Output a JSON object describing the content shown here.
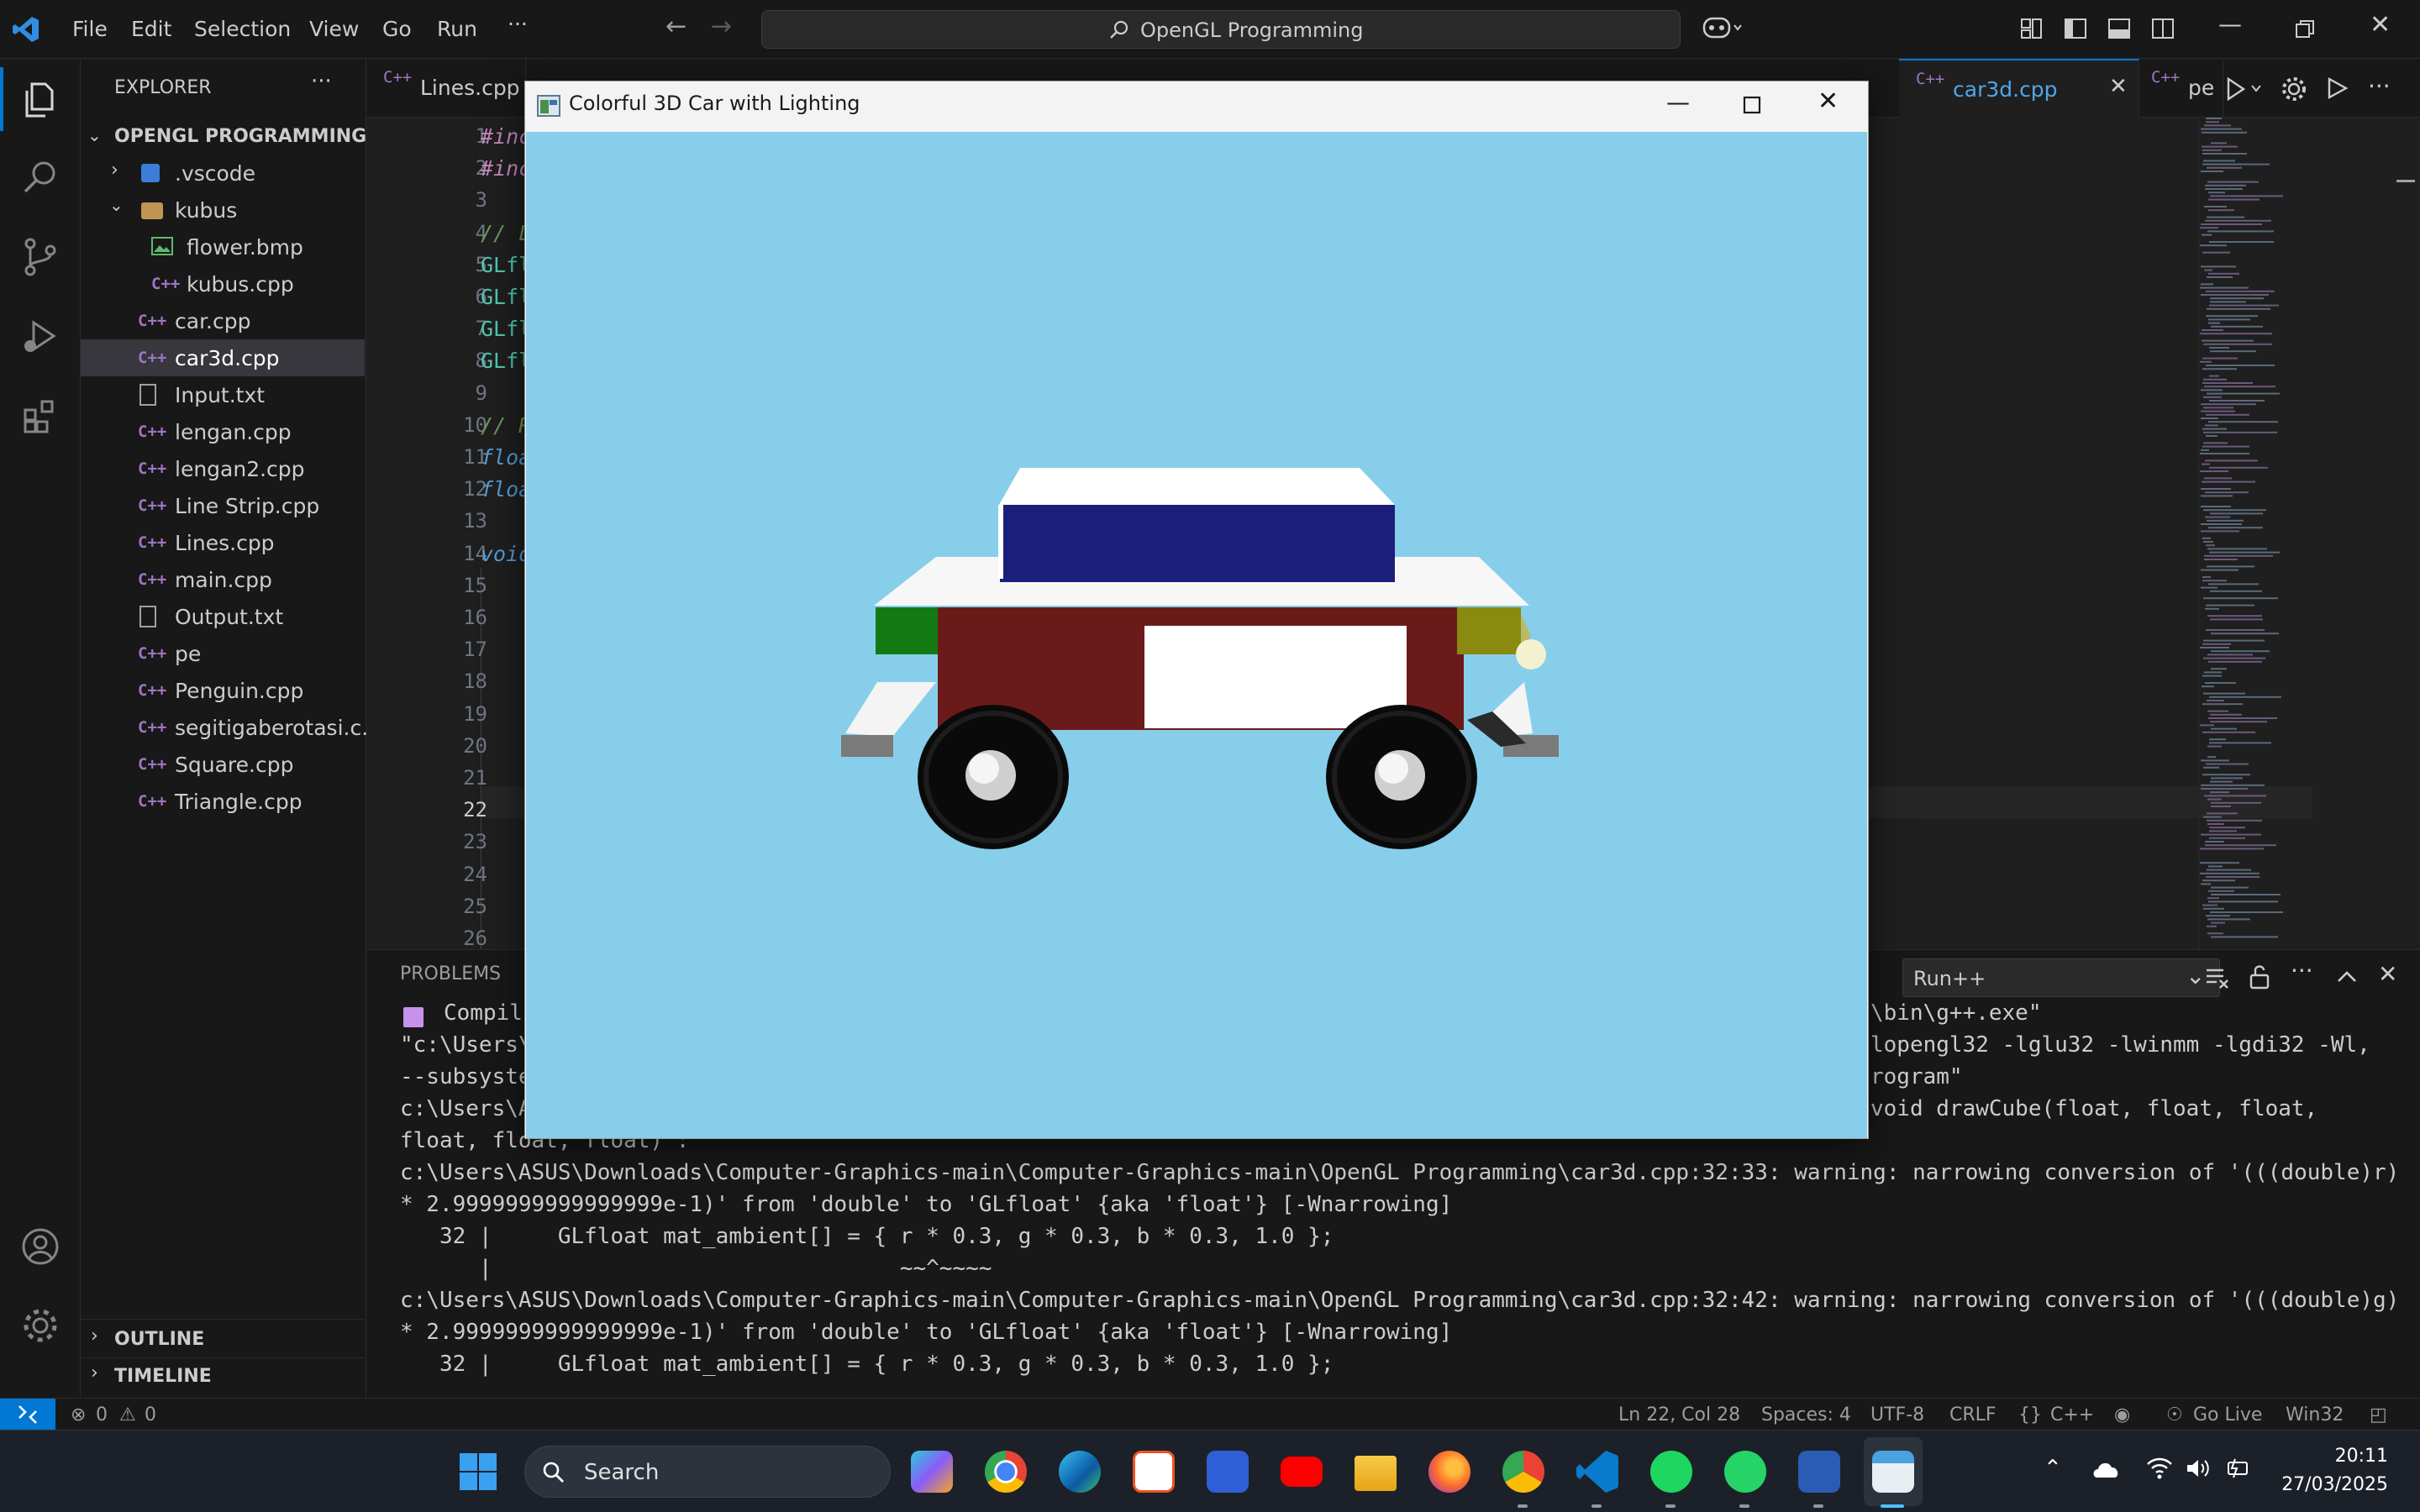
{
  "titlebar": {
    "menu": [
      "File",
      "Edit",
      "Selection",
      "View",
      "Go",
      "Run",
      "···"
    ],
    "search_text": "OpenGL Programming"
  },
  "sidebar": {
    "header": "EXPLORER",
    "project": "OPENGL PROGRAMMING",
    "items": [
      {
        "label": ".vscode",
        "type": "folder"
      },
      {
        "label": "kubus",
        "type": "folder-open"
      },
      {
        "label": "flower.bmp",
        "type": "image"
      },
      {
        "label": "kubus.cpp",
        "type": "cpp"
      },
      {
        "label": "car.cpp",
        "type": "cpp"
      },
      {
        "label": "car3d.cpp",
        "type": "cpp"
      },
      {
        "label": "Input.txt",
        "type": "txt"
      },
      {
        "label": "lengan.cpp",
        "type": "cpp"
      },
      {
        "label": "lengan2.cpp",
        "type": "cpp"
      },
      {
        "label": "Line Strip.cpp",
        "type": "cpp"
      },
      {
        "label": "Lines.cpp",
        "type": "cpp"
      },
      {
        "label": "main.cpp",
        "type": "cpp"
      },
      {
        "label": "Output.txt",
        "type": "txt"
      },
      {
        "label": "pe",
        "type": "txt"
      },
      {
        "label": "Penguin.cpp",
        "type": "cpp"
      },
      {
        "label": "segitigaberotasi.c...",
        "type": "cpp"
      },
      {
        "label": "Square.cpp",
        "type": "cpp"
      },
      {
        "label": "Triangle.cpp",
        "type": "cpp"
      }
    ],
    "outline": "OUTLINE",
    "timeline": "TIMELINE"
  },
  "tabs": [
    "Lines.cpp",
    "car3d.cpp",
    "pe"
  ],
  "editor": {
    "line_numbers": [
      "1",
      "2",
      "3",
      "4",
      "5",
      "6",
      "7",
      "8",
      "9",
      "10",
      "11",
      "12",
      "13",
      "14",
      "15",
      "16",
      "17",
      "18",
      "19",
      "20",
      "21",
      "22",
      "23",
      "24",
      "25",
      "26"
    ],
    "code_fragments": [
      "#inc",
      "#inc",
      "",
      "// L",
      "GLfl",
      "GLfl",
      "GLfl",
      "GLfl",
      "",
      "// R",
      "floa",
      "floa",
      "",
      "void"
    ]
  },
  "panel": {
    "tab": "PROBLEMS",
    "runner": "Run++",
    "left_lines": [
      "Compil",
      "\"c:\\Users\\",
      "--subsyste",
      "c:\\Users\\A",
      "float, float, float)':",
      "c:\\Users\\ASUS\\Downloads\\Computer-Graphics-main\\Computer-Graphics-main\\OpenGL Programming\\car3d.cpp:32:33: warning: narrowing conversion of '(((double)r)",
      "* 2.9999999999999999e-1)' from 'double' to 'GLfloat' {aka 'float'} [-Wnarrowing]",
      "   32 |     GLfloat mat_ambient[] = { r * 0.3, g * 0.3, b * 0.3, 1.0 };",
      "      |                               ~~^~~~~",
      "c:\\Users\\ASUS\\Downloads\\Computer-Graphics-main\\Computer-Graphics-main\\OpenGL Programming\\car3d.cpp:32:42: warning: narrowing conversion of '(((double)g)",
      "* 2.9999999999999999e-1)' from 'double' to 'GLfloat' {aka 'float'} [-Wnarrowing]",
      "   32 |     GLfloat mat_ambient[] = { r * 0.3, g * 0.3, b * 0.3, 1.0 };"
    ],
    "right_lines": [
      "\\bin\\g++.exe\"",
      "lopengl32 -lglu32 -lwinmm -lgdi32 -Wl,",
      "rogram\"",
      "void drawCube(float, float, float,"
    ]
  },
  "statusbar": {
    "errors": "0",
    "warnings": "0",
    "position": "Ln 22, Col 28",
    "spaces": "Spaces: 4",
    "encoding": "UTF-8",
    "eol": "CRLF",
    "language": "C++",
    "golive": "Go Live",
    "platform": "Win32"
  },
  "glwindow": {
    "title": "Colorful 3D Car with Lighting"
  },
  "taskbar": {
    "search": "Search",
    "time": "20:11",
    "date": "27/03/2025"
  },
  "colors": {
    "sky": "#87ceeb",
    "car_body": "#6b1a1a",
    "roof": "#1c1f7a",
    "accent": "#0078d4"
  }
}
